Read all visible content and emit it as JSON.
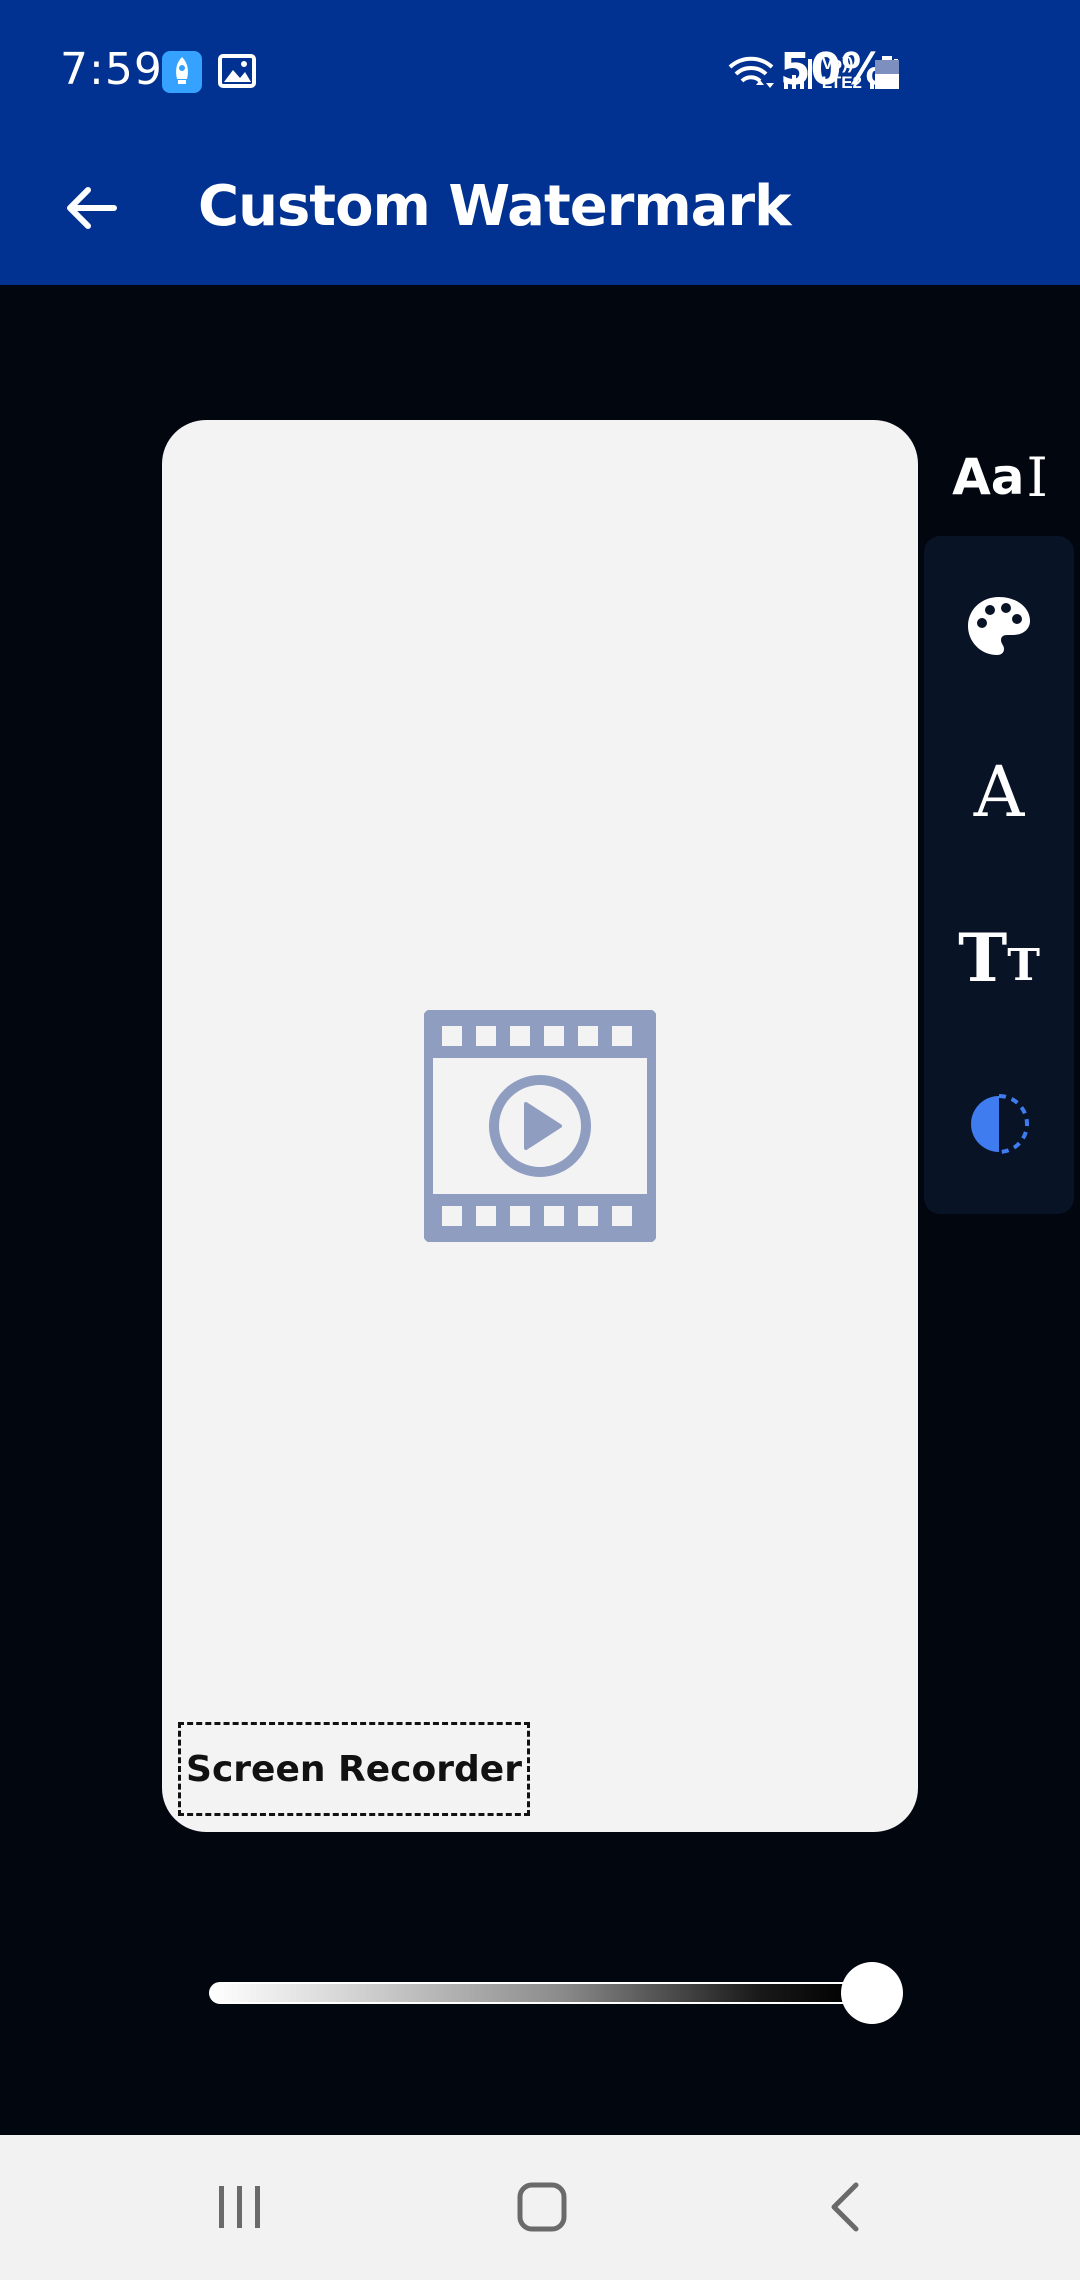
{
  "status_bar": {
    "time": "7:59",
    "battery": "50%",
    "network_label_top": "Vo))",
    "network_label_bottom": "LTE2"
  },
  "app_bar": {
    "title": "Custom Watermark"
  },
  "toolbar": {
    "font_style_label": "Aa",
    "font_label": "A",
    "size_label_big": "T",
    "size_label_small": "T"
  },
  "preview": {
    "watermark_text": "Screen Recorder"
  },
  "slider": {
    "value_fraction": 1.0
  },
  "colors": {
    "app_bar": "#023291",
    "background": "#02060f",
    "panel": "#081325",
    "video_icon": "#8e9dc0",
    "contrast_icon": "#3f7cf0"
  }
}
